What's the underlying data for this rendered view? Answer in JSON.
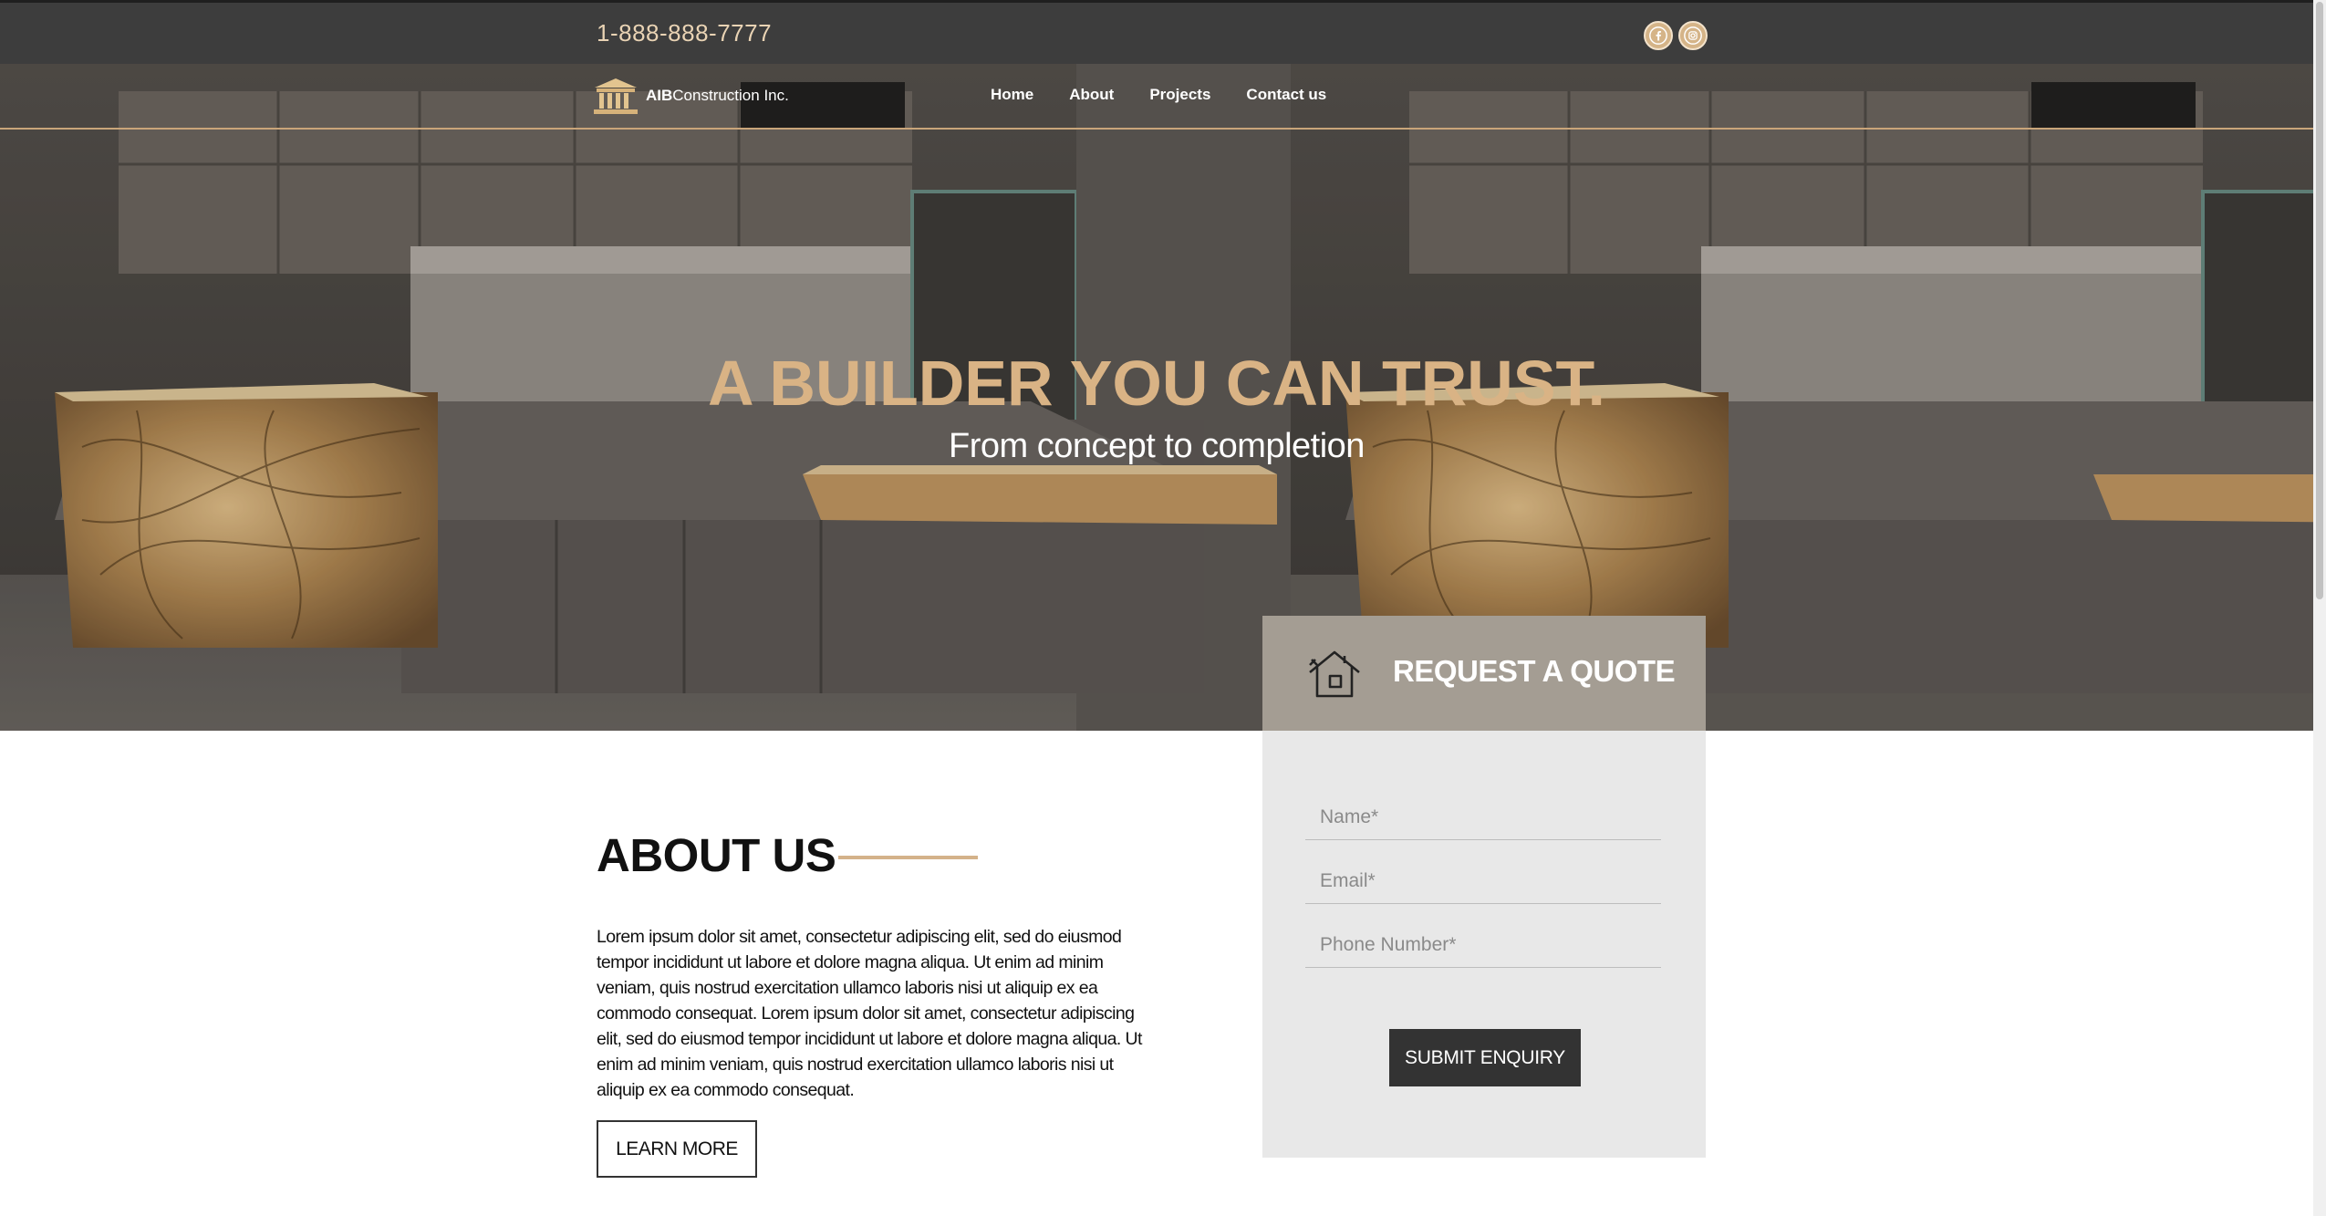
{
  "topbar": {
    "phone": "1-888-888-7777",
    "social": [
      {
        "icon": "facebook-icon"
      },
      {
        "icon": "instagram-icon"
      }
    ]
  },
  "nav": {
    "logo_bold": "AIB",
    "logo_rest": "Construction Inc.",
    "items": [
      "Home",
      "About",
      "Projects",
      "Contact us"
    ]
  },
  "hero": {
    "title": "A BUILDER YOU CAN TRUST.",
    "subtitle": "From concept to completion"
  },
  "quote": {
    "title": "REQUEST A QUOTE",
    "icon": "house-tools-icon",
    "name_placeholder": "Name*",
    "email_placeholder": "Email*",
    "phone_placeholder": "Phone Number*",
    "submit_label": "SUBMIT ENQUIRY"
  },
  "about": {
    "title": "ABOUT US",
    "body": "Lorem ipsum dolor sit amet, consectetur adipiscing elit, sed do eiusmod tempor incididunt ut labore et dolore magna aliqua. Ut enim ad minim veniam, quis nostrud exercitation ullamco laboris nisi ut aliquip ex ea commodo consequat. Lorem ipsum dolor sit amet, consectetur adipiscing elit, sed do eiusmod tempor incididunt ut labore et dolore magna aliqua. Ut enim ad minim veniam, quis nostrud exercitation ullamco laboris nisi ut aliquip ex ea commodo consequat.",
    "button_label": "LEARN MORE"
  },
  "colors": {
    "accent": "#d9b385",
    "topbar": "#3d3d3d",
    "quote_head": "#a49d93",
    "quote_body": "#e8e8e8",
    "button_dark": "#333333"
  }
}
